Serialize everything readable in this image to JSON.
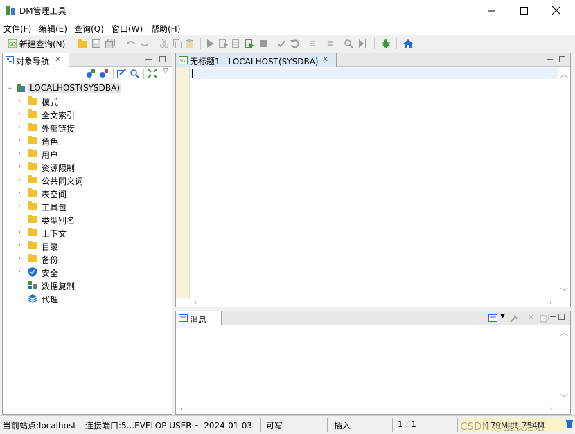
{
  "window": {
    "title": "DM管理工具",
    "controls": {
      "minimize": "—",
      "maximize": "☐",
      "close": "✕"
    }
  },
  "menu": [
    "文件(F)",
    "编辑(E)",
    "查询(Q)",
    "窗口(W)",
    "帮助(H)"
  ],
  "toolbar": {
    "new_query_label": "新建查询(N)",
    "icons": [
      "open-folder-icon",
      "save-icon",
      "save-all-icon",
      "undo-icon",
      "redo-icon",
      "cut-icon",
      "copy-icon",
      "paste-icon",
      "run-icon",
      "run-selected-icon",
      "run-step-icon",
      "run-script-icon",
      "stop-icon",
      "commit-icon",
      "rollback-icon",
      "explain-icon",
      "format-icon",
      "find-icon",
      "debug-step-icon",
      "bug-icon",
      "home-icon"
    ]
  },
  "navigator": {
    "tab_label": "对象导航",
    "root": "LOCALHOST(SYSDBA)",
    "items": [
      {
        "label": "模式",
        "icon": "folder-icon",
        "expandable": true
      },
      {
        "label": "全文索引",
        "icon": "folder-icon",
        "expandable": true
      },
      {
        "label": "外部链接",
        "icon": "folder-icon",
        "expandable": true
      },
      {
        "label": "角色",
        "icon": "folder-icon",
        "expandable": true
      },
      {
        "label": "用户",
        "icon": "folder-icon",
        "expandable": true
      },
      {
        "label": "资源限制",
        "icon": "folder-icon",
        "expandable": true
      },
      {
        "label": "公共同义词",
        "icon": "folder-icon",
        "expandable": true
      },
      {
        "label": "表空间",
        "icon": "folder-icon",
        "expandable": true
      },
      {
        "label": "工具包",
        "icon": "folder-icon",
        "expandable": true
      },
      {
        "label": "类型别名",
        "icon": "folder-icon",
        "expandable": false
      },
      {
        "label": "上下文",
        "icon": "folder-icon",
        "expandable": true
      },
      {
        "label": "目录",
        "icon": "folder-icon",
        "expandable": true
      },
      {
        "label": "备份",
        "icon": "folder-icon",
        "expandable": true
      },
      {
        "label": "安全",
        "icon": "shield-icon",
        "expandable": true
      },
      {
        "label": "数据复制",
        "icon": "replication-icon",
        "expandable": false
      },
      {
        "label": "代理",
        "icon": "layers-icon",
        "expandable": false
      }
    ]
  },
  "editor": {
    "tab_label": "无标题1 - LOCALHOST(SYSDBA)",
    "content": ""
  },
  "messages": {
    "tab_label": "消息"
  },
  "status": {
    "site": "当前站点:localhost",
    "connection": "连接端口:5...EVELOP USER ~ 2024-01-03",
    "mode": "可写",
    "insert": "插入",
    "position": "1 : 1",
    "memory": "179M 共 754M",
    "watermark": "CSDN @星辰浩落"
  },
  "colors": {
    "folder": "#f2c12e",
    "accent_blue": "#1e6fd9",
    "current_line": "#e8f2fe",
    "gutter": "#f7f2dc"
  }
}
